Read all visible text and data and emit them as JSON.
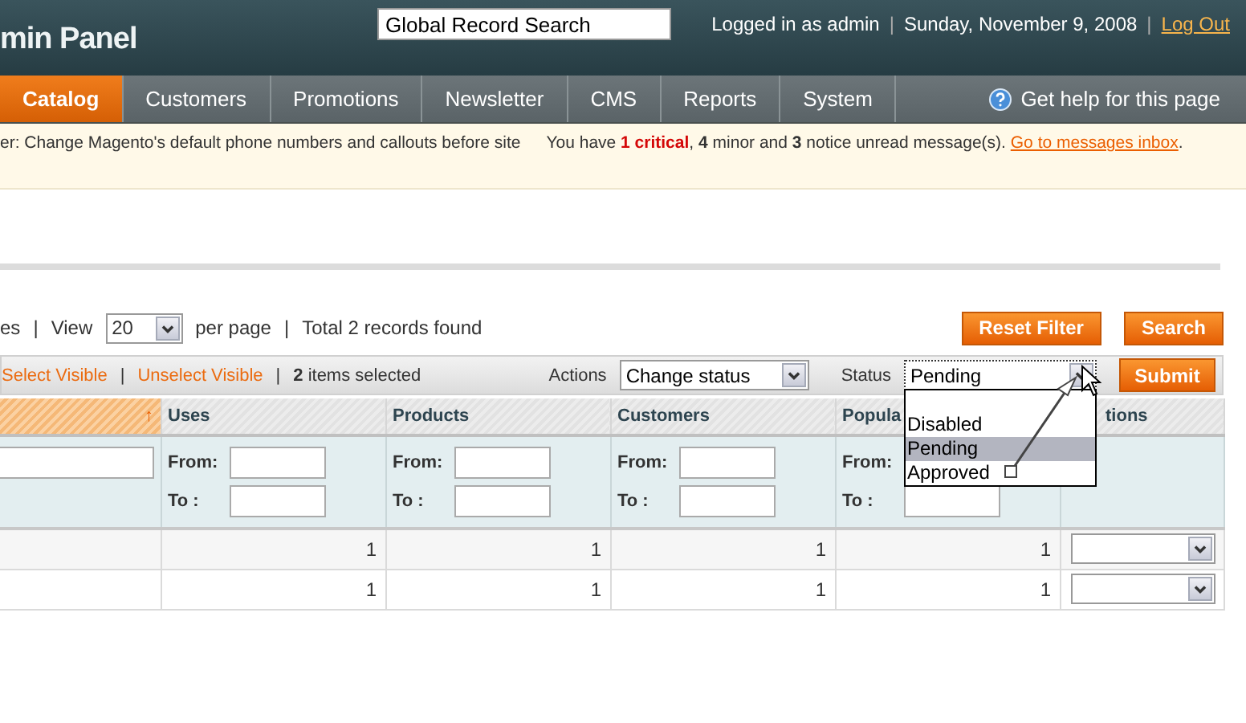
{
  "header": {
    "logo": "min Panel",
    "search": {
      "value": "Global Record Search"
    },
    "user": "Logged in as admin",
    "date": "Sunday, November 9, 2008",
    "logout": "Log Out",
    "separators": [
      "|",
      "|"
    ]
  },
  "nav": {
    "items": [
      {
        "label": "Catalog",
        "selected": true
      },
      {
        "label": "Customers",
        "selected": false
      },
      {
        "label": "Promotions",
        "selected": false
      },
      {
        "label": "Newsletter",
        "selected": false
      },
      {
        "label": "CMS",
        "selected": false
      },
      {
        "label": "Reports",
        "selected": false
      },
      {
        "label": "System",
        "selected": false
      }
    ],
    "help": "Get help for this page"
  },
  "notice": {
    "message": "er: Change Magento's default phone numbers and callouts before site",
    "summary": [
      {
        "text": "You have ",
        "kind": "plain"
      },
      {
        "text": "1 critical",
        "kind": "critical"
      },
      {
        "text": ", ",
        "kind": "plain"
      },
      {
        "text": "4",
        "kind": "count"
      },
      {
        "text": " minor and ",
        "kind": "plain"
      },
      {
        "text": "3",
        "kind": "count"
      },
      {
        "text": " notice unread message(s). ",
        "kind": "plain"
      }
    ],
    "link": "Go to messages inbox",
    "tail": "."
  },
  "pager": {
    "prefix": "es",
    "view_label": "View",
    "per_page": "20",
    "per_page_label": "per page",
    "total": "Total 2 records found",
    "separators": [
      "|",
      "|"
    ]
  },
  "buttons": [
    "Reset Filter",
    "Search"
  ],
  "massaction": {
    "links": [
      "Select Visible",
      "Unselect Visible"
    ],
    "separators": [
      "|",
      "|"
    ],
    "selected_count": "2",
    "selected_label": "items selected",
    "actions_label": "Actions",
    "action": "Change status",
    "status_label": "Status",
    "status": "Pending",
    "expanded": true,
    "options": [
      {
        "label": "Disabled",
        "selected": false
      },
      {
        "label": "Pending",
        "selected": true
      },
      {
        "label": "Approved",
        "selected": false
      }
    ],
    "submit": "Submit"
  },
  "table": {
    "columns": [
      {
        "kind": "sorted",
        "arrow": "↑"
      },
      {
        "kind": "range",
        "label": "Uses",
        "from_label": "From:",
        "to_label": "To :"
      },
      {
        "kind": "range",
        "label": "Products",
        "from_label": "From:",
        "to_label": "To :"
      },
      {
        "kind": "range",
        "label": "Customers",
        "from_label": "From:",
        "to_label": "To :"
      },
      {
        "kind": "range",
        "label": "Popula",
        "from_label": "From:",
        "to_label": "To :"
      },
      {
        "kind": "action",
        "label": "tions"
      }
    ],
    "rows": [
      {
        "cells": [
          "",
          "1",
          "1",
          "1",
          "1"
        ]
      },
      {
        "cells": [
          "",
          "1",
          "1",
          "1",
          "1"
        ]
      }
    ]
  }
}
